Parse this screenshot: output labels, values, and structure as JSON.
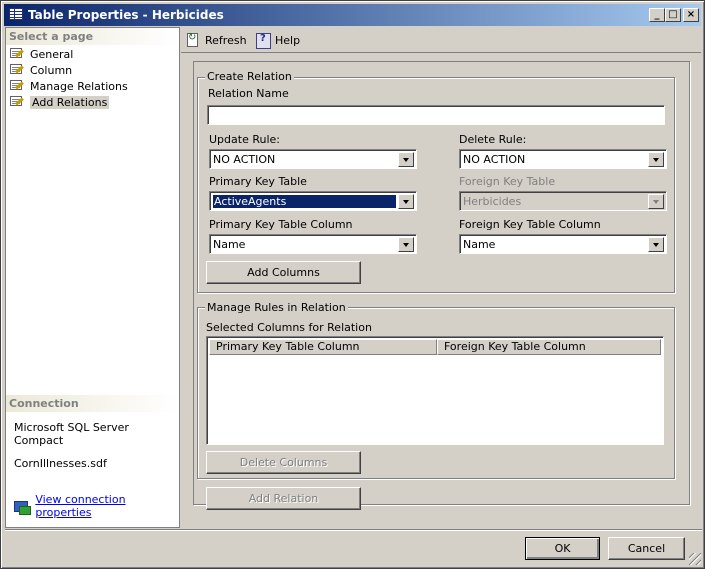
{
  "window": {
    "title": "Table Properties - Herbicides"
  },
  "title_buttons": {
    "minimize": "_",
    "maximize": "□",
    "close": "×"
  },
  "sidebar": {
    "heading": "Select a page",
    "items": [
      {
        "label": "General",
        "icon": "page-icon"
      },
      {
        "label": "Column",
        "icon": "page-icon"
      },
      {
        "label": "Manage Relations",
        "icon": "page-icon"
      },
      {
        "label": "Add Relations",
        "icon": "page-icon",
        "selected": true
      }
    ]
  },
  "connection": {
    "heading": "Connection",
    "server": "Microsoft SQL Server Compact",
    "database": "CornIllnesses.sdf",
    "link": "View connection properties"
  },
  "toolbar": {
    "refresh": "Refresh",
    "help": "Help"
  },
  "create_relation": {
    "legend": "Create Relation",
    "relation_name_label": "Relation Name",
    "relation_name_value": "",
    "update_rule_label": "Update Rule:",
    "update_rule_value": "NO ACTION",
    "delete_rule_label": "Delete Rule:",
    "delete_rule_value": "NO ACTION",
    "pk_table_label": "Primary Key Table",
    "pk_table_value": "ActiveAgents",
    "fk_table_label": "Foreign Key Table",
    "fk_table_value": "Herbicides",
    "pk_column_label": "Primary Key Table Column",
    "pk_column_value": "Name",
    "fk_column_label": "Foreign Key Table Column",
    "fk_column_value": "Name",
    "add_columns": "Add Columns"
  },
  "manage_rules": {
    "legend": "Manage Rules in Relation",
    "selected_columns_label": "Selected Columns for Relation",
    "columns": [
      "Primary Key Table Column",
      "Foreign Key Table Column"
    ],
    "delete_columns": "Delete Columns"
  },
  "add_relation": "Add Relation",
  "footer": {
    "ok": "OK",
    "cancel": "Cancel"
  }
}
